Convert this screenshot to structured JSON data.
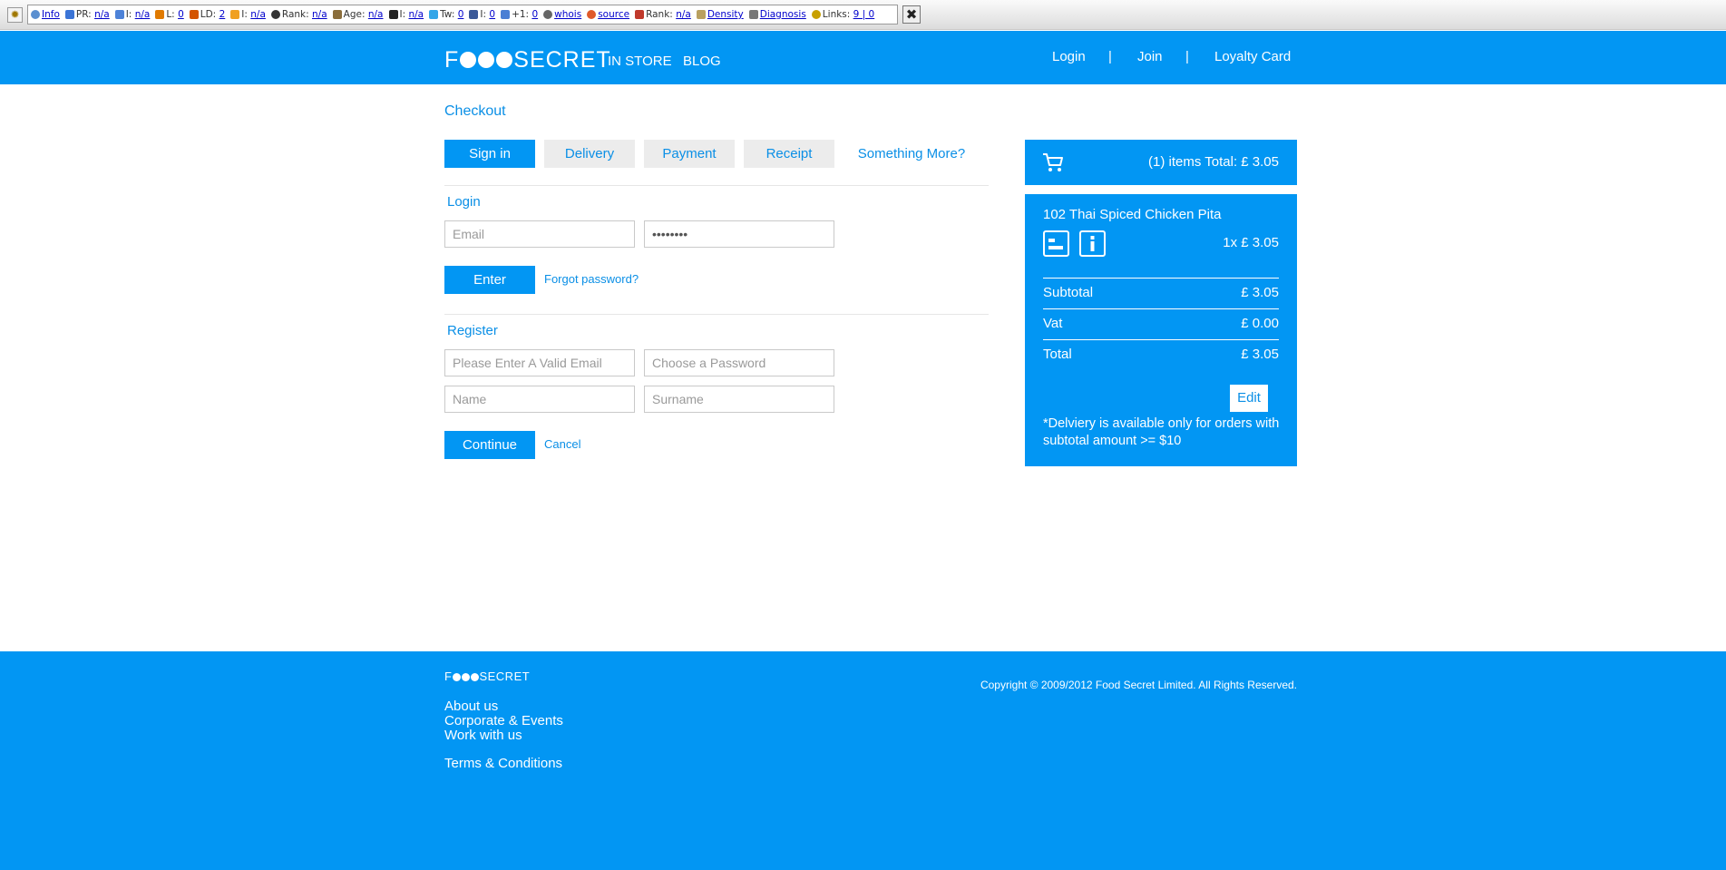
{
  "seo_toolbar": {
    "items": [
      {
        "label": "",
        "value": "Info"
      },
      {
        "label": "PR:",
        "value": "n/a"
      },
      {
        "label": "I:",
        "value": "n/a"
      },
      {
        "label": "L:",
        "value": "0"
      },
      {
        "label": "LD:",
        "value": "2"
      },
      {
        "label": "I:",
        "value": "n/a"
      },
      {
        "label": "Rank:",
        "value": "n/a"
      },
      {
        "label": "Age:",
        "value": "n/a"
      },
      {
        "label": "I:",
        "value": "n/a"
      },
      {
        "label": "Tw:",
        "value": "0"
      },
      {
        "label": "I:",
        "value": "0"
      },
      {
        "label": "+1:",
        "value": "0"
      },
      {
        "label": "",
        "value": "whois"
      },
      {
        "label": "",
        "value": "source"
      },
      {
        "label": "Rank:",
        "value": "n/a"
      },
      {
        "label": "",
        "value": "Density"
      },
      {
        "label": "",
        "value": "Diagnosis"
      },
      {
        "label": "Links:",
        "value": "9 | 0"
      }
    ]
  },
  "header": {
    "logo_pre": "F",
    "logo_post": "SECRET",
    "nav": [
      "IN STORE",
      "BLOG"
    ],
    "right_nav": [
      "Login",
      "|",
      "Join",
      "|",
      "Loyalty Card"
    ]
  },
  "checkout": {
    "title": "Checkout",
    "steps": [
      "Sign in",
      "Delivery",
      "Payment",
      "Receipt"
    ],
    "something_more": "Something More?",
    "login": {
      "heading": "Login",
      "email_placeholder": "Email",
      "password_value": "••••••••",
      "enter_label": "Enter",
      "forgot_label": "Forgot password?"
    },
    "register": {
      "heading": "Register",
      "email_placeholder": "Please Enter A Valid Email",
      "password_placeholder": "Choose a Password",
      "name_placeholder": "Name",
      "surname_placeholder": "Surname",
      "continue_label": "Continue",
      "cancel_label": "Cancel"
    }
  },
  "cart": {
    "summary": "(1) items Total: £ 3.05",
    "item_name": "102 Thai Spiced Chicken Pita",
    "item_qty_price": "1x £ 3.05",
    "subtotal_label": "Subtotal",
    "subtotal_value": "£ 3.05",
    "vat_label": "Vat",
    "vat_value": "£ 0.00",
    "total_label": "Total",
    "total_value": "£ 3.05",
    "edit_label": "Edit",
    "note": "*Delviery is available only for orders with subtotal amount >= $10"
  },
  "footer": {
    "logo_pre": "F",
    "logo_post": "SECRET",
    "links": [
      "About us",
      "Corporate & Events",
      "Work with us",
      "Terms & Conditions"
    ],
    "copyright": "Copyright © 2009/2012 Food Secret Limited. All Rights Reserved."
  },
  "colors": {
    "brand_blue": "#0296f3",
    "link_blue": "#0a8fe6",
    "step_inactive": "#ececec"
  }
}
